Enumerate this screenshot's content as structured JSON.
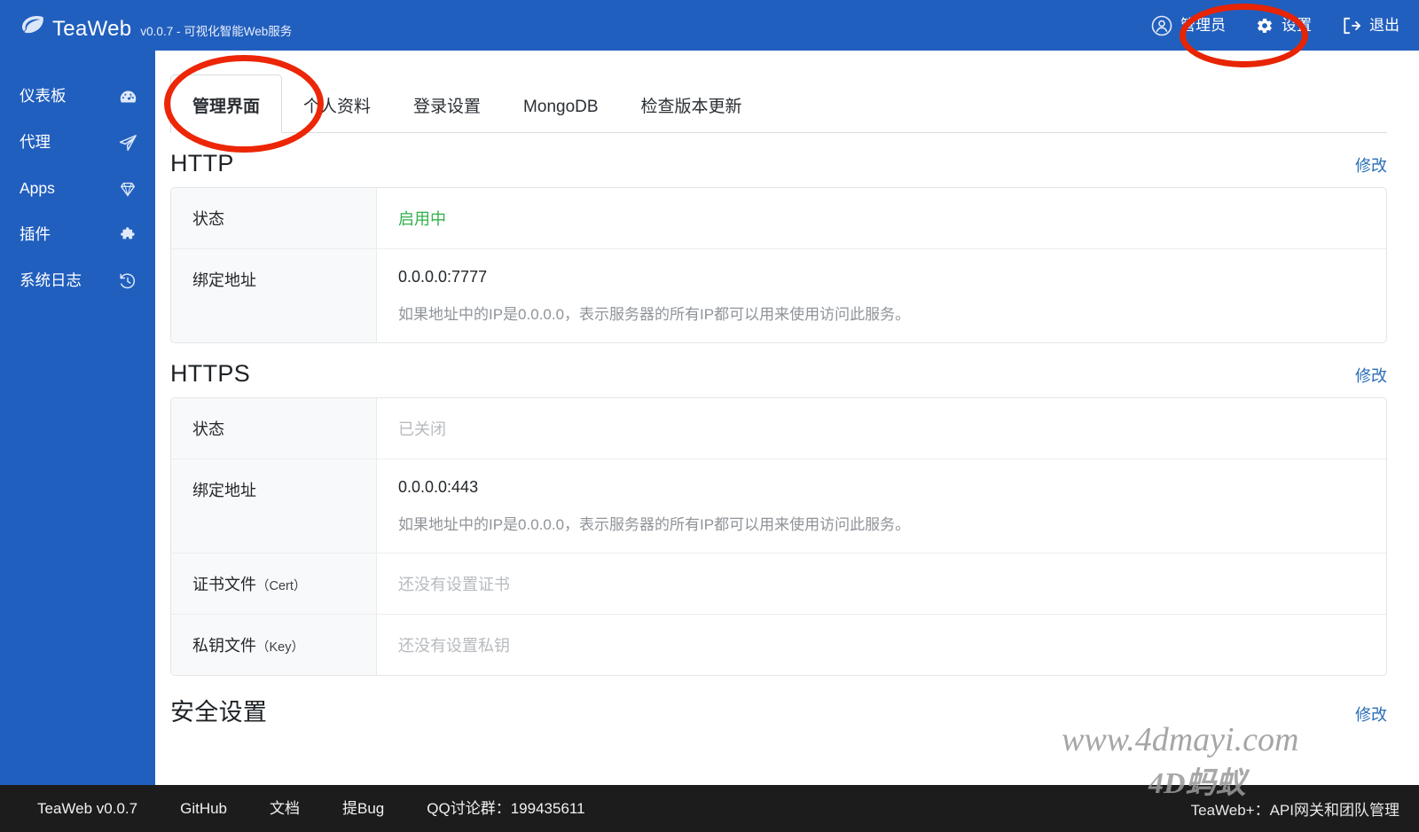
{
  "header": {
    "brand_name": "TeaWeb",
    "brand_subtitle": "v0.0.7 - 可视化智能Web服务",
    "user_label": "管理员",
    "settings_label": "设置",
    "logout_label": "退出"
  },
  "sidebar": {
    "items": [
      {
        "label": "仪表板",
        "icon": "dashboard-icon"
      },
      {
        "label": "代理",
        "icon": "paper-plane-icon"
      },
      {
        "label": "Apps",
        "icon": "diamond-icon"
      },
      {
        "label": "插件",
        "icon": "puzzle-icon"
      },
      {
        "label": "系统日志",
        "icon": "history-icon"
      }
    ]
  },
  "tabs": [
    {
      "label": "管理界面",
      "active": true
    },
    {
      "label": "个人资料",
      "active": false
    },
    {
      "label": "登录设置",
      "active": false
    },
    {
      "label": "MongoDB",
      "active": false
    },
    {
      "label": "检查版本更新",
      "active": false
    }
  ],
  "sections": [
    {
      "title": "HTTP",
      "edit_label": "修改",
      "rows": [
        {
          "key": "状态",
          "key_paren": "",
          "value": "启用中",
          "value_style": "on",
          "hint": ""
        },
        {
          "key": "绑定地址",
          "key_paren": "",
          "value": "0.0.0.0:7777",
          "value_style": "normal",
          "hint": "如果地址中的IP是0.0.0.0，表示服务器的所有IP都可以用来使用访问此服务。"
        }
      ]
    },
    {
      "title": "HTTPS",
      "edit_label": "修改",
      "rows": [
        {
          "key": "状态",
          "key_paren": "",
          "value": "已关闭",
          "value_style": "muted",
          "hint": ""
        },
        {
          "key": "绑定地址",
          "key_paren": "",
          "value": "0.0.0.0:443",
          "value_style": "normal",
          "hint": "如果地址中的IP是0.0.0.0，表示服务器的所有IP都可以用来使用访问此服务。"
        },
        {
          "key": "证书文件",
          "key_paren": "（Cert）",
          "value": "还没有设置证书",
          "value_style": "muted",
          "hint": ""
        },
        {
          "key": "私钥文件",
          "key_paren": "（Key）",
          "value": "还没有设置私钥",
          "value_style": "muted",
          "hint": ""
        }
      ]
    },
    {
      "title": "安全设置",
      "edit_label": "修改",
      "rows": []
    }
  ],
  "footer": {
    "links": [
      "TeaWeb v0.0.7",
      "GitHub",
      "文档",
      "提Bug",
      "QQ讨论群：199435611"
    ],
    "right_text": "TeaWeb+：API网关和团队管理"
  },
  "watermarks": {
    "url": "www.4dmayi.com",
    "brand": "4D蚂蚁"
  },
  "colors": {
    "brand_blue": "#215FBE",
    "status_on_green": "#31b04a",
    "link_blue": "#2a6eb8",
    "annotation_red": "#e72404",
    "footer_dark": "#1c1c1c"
  }
}
